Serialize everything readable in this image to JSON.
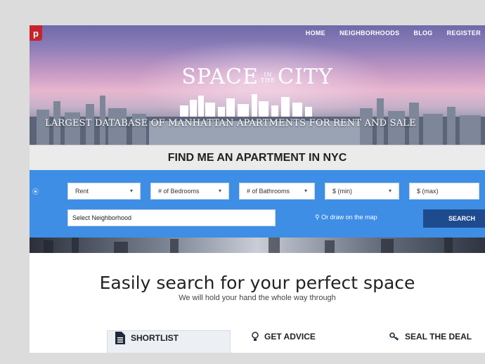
{
  "header": {
    "nav": [
      "HOME",
      "NEIGHBORHOODS",
      "BLOG",
      "REGISTER"
    ],
    "pinterest_glyph": "p"
  },
  "brand": {
    "space": "SPACE",
    "in": "IN",
    "the": "THE",
    "city": "CITY"
  },
  "hero": {
    "tagline": "LARGEST DATABASE OF MANHATTAN APARTMENTS FOR RENT AND SALE"
  },
  "find_bar": {
    "title": "FIND ME AN APARTMENT IN NYC"
  },
  "search": {
    "filters": [
      {
        "value": "Rent"
      },
      {
        "value": "# of Bedrooms"
      },
      {
        "value": "# of Bathrooms"
      },
      {
        "value": "$ (min)"
      },
      {
        "value": "$ (max)"
      }
    ],
    "neighborhood_value": "Select Neighborhood",
    "draw_map": "Or draw on the map",
    "button": "SEARCH"
  },
  "main": {
    "title": "Easily search for your perfect space",
    "subtitle": "We will hold your hand the whole way through",
    "features": [
      {
        "label": "SHORTLIST",
        "icon": "document-icon"
      },
      {
        "label": "GET ADVICE",
        "icon": "lightbulb-icon"
      },
      {
        "label": "SEAL THE DEAL",
        "icon": "key-icon"
      }
    ]
  },
  "colors": {
    "search_panel": "#3e8ee6",
    "search_button": "#1e4b8e",
    "pinterest_red": "#c8232c"
  }
}
